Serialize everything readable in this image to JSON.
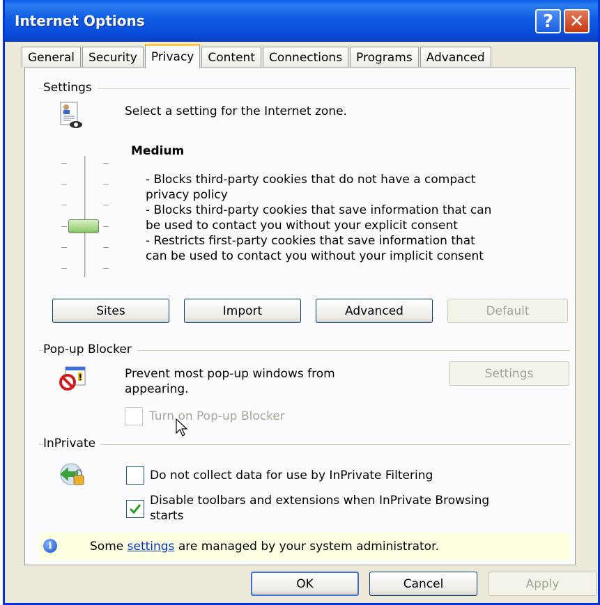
{
  "window": {
    "title": "Internet Options",
    "help_glyph": "?",
    "close_glyph": "✕"
  },
  "tabs": [
    {
      "label": "General",
      "active": false
    },
    {
      "label": "Security",
      "active": false
    },
    {
      "label": "Privacy",
      "active": true
    },
    {
      "label": "Content",
      "active": false
    },
    {
      "label": "Connections",
      "active": false
    },
    {
      "label": "Programs",
      "active": false
    },
    {
      "label": "Advanced",
      "active": false
    }
  ],
  "settings": {
    "group_label": "Settings",
    "icon": "privacy-document-eye-icon",
    "intro": "Select a setting for the Internet zone.",
    "level_name": "Medium",
    "slider_level": "Medium",
    "description_lines": [
      "- Blocks third-party cookies that do not have a compact",
      "privacy policy",
      "- Blocks third-party cookies that save information that can",
      "be used to contact you without your explicit consent",
      "- Restricts first-party cookies that save information that",
      "can be used to contact you without your implicit consent"
    ],
    "buttons": {
      "sites": "Sites",
      "import": "Import",
      "advanced": "Advanced",
      "default": "Default"
    }
  },
  "popup": {
    "group_label": "Pop-up Blocker",
    "icon": "popup-blocker-icon",
    "text_line1": "Prevent most pop-up windows from",
    "text_line2": "appearing.",
    "settings_button": "Settings",
    "checkbox_label": "Turn on Pop-up Blocker",
    "checkbox_checked": false,
    "checkbox_enabled": false
  },
  "inprivate": {
    "group_label": "InPrivate",
    "icon": "inprivate-icon",
    "option1_label": "Do not collect data for use by InPrivate Filtering",
    "option1_checked": false,
    "option2_line1": "Disable toolbars and extensions when InPrivate Browsing",
    "option2_line2": "starts",
    "option2_checked": true
  },
  "notice": {
    "icon": "info-icon",
    "info_glyph": "i",
    "text_before": "Some ",
    "link_text": "settings",
    "text_after": " are managed by your system administrator."
  },
  "footer": {
    "ok": "OK",
    "cancel": "Cancel",
    "apply": "Apply"
  },
  "colors": {
    "titlebar": "#0a5fe8",
    "dialog_bg": "#ece9d8",
    "notice_bg": "#ffffe1",
    "check": "#21a121"
  }
}
